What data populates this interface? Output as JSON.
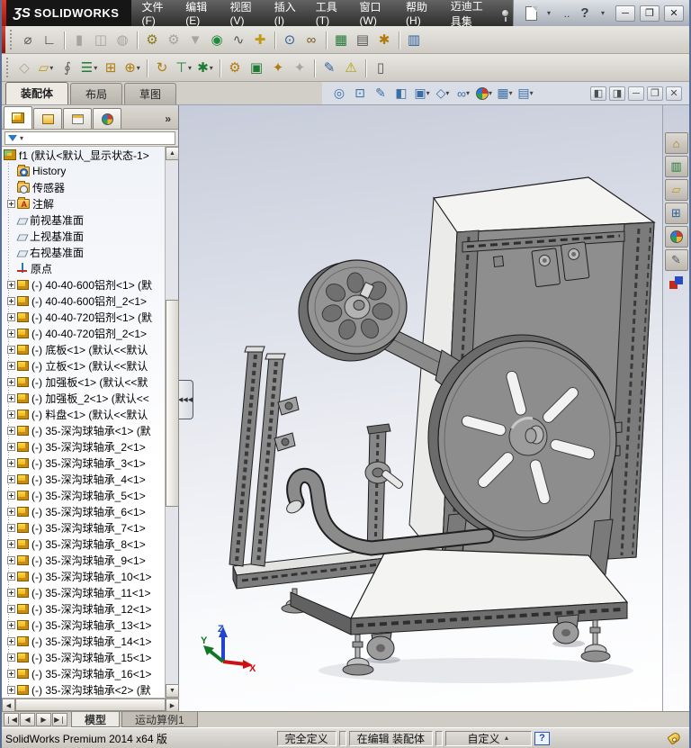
{
  "titlebar": {
    "logo_mark": "ƷS",
    "logo_text": "SOLIDWORKS",
    "menus": [
      {
        "name": "menu-file",
        "label": "文件(F)"
      },
      {
        "name": "menu-edit",
        "label": "编辑(E)"
      },
      {
        "name": "menu-view",
        "label": "视图(V)"
      },
      {
        "name": "menu-insert",
        "label": "插入(I)"
      },
      {
        "name": "menu-tools",
        "label": "工具(T)"
      },
      {
        "name": "menu-window",
        "label": "窗口(W)"
      },
      {
        "name": "menu-help",
        "label": "帮助(H)"
      },
      {
        "name": "menu-maidi-toolkit",
        "label": "迈迪工具集"
      }
    ],
    "quick_dots": "..",
    "help_glyph": "?",
    "min_glyph": "─",
    "restore_glyph": "❐",
    "close_glyph": "✕"
  },
  "toolbar1": [
    {
      "name": "screw-fastener-icon",
      "glyph": "⌀",
      "color": "#5a5a5a"
    },
    {
      "name": "corner-angle-icon",
      "glyph": "∟",
      "color": "#333333"
    },
    {
      "name": "publish-emodel-icon",
      "glyph": "▮",
      "color": "#888",
      "cls": "sep grayed"
    },
    {
      "name": "collaborate-icon",
      "glyph": "◫",
      "color": "#888",
      "cls": "grayed"
    },
    {
      "name": "web-globe-icon",
      "glyph": "◍",
      "color": "#888",
      "cls": "grayed"
    },
    {
      "name": "options-gear-icon",
      "glyph": "⚙",
      "color": "#8a7a1e",
      "cls": "sep"
    },
    {
      "name": "gear-disabled-icon",
      "glyph": "⚙",
      "color": "#888",
      "cls": "grayed"
    },
    {
      "name": "filter-funnel-icon",
      "glyph": "▼",
      "color": "#888",
      "cls": "grayed"
    },
    {
      "name": "location-pin-icon",
      "glyph": "◉",
      "color": "#1e8a3c"
    },
    {
      "name": "spring-icon",
      "glyph": "∿",
      "color": "#555555"
    },
    {
      "name": "move-cross-icon",
      "glyph": "✚",
      "color": "#c09a10"
    },
    {
      "name": "search-icon",
      "glyph": "⊙",
      "color": "#2b5fa0",
      "cls": "sep"
    },
    {
      "name": "binoculars-icon",
      "glyph": "∞",
      "color": "#7a5c20"
    },
    {
      "name": "excel-export-icon",
      "glyph": "▦",
      "color": "#1e7a34",
      "cls": "sep"
    },
    {
      "name": "print-icon",
      "glyph": "▤",
      "color": "#555555"
    },
    {
      "name": "new-doc-wizard-icon",
      "glyph": "✱",
      "color": "#b07c10"
    },
    {
      "name": "design-binder-icon",
      "glyph": "▥",
      "color": "#2b5fa0",
      "cls": "sep"
    }
  ],
  "toolbar2": [
    {
      "name": "insert-component-icon",
      "glyph": "◇",
      "color": "#888",
      "cls": "grayed"
    },
    {
      "name": "open-part-icon",
      "glyph": "▱",
      "color": "#c09a10",
      "caret": true
    },
    {
      "name": "mate-icon",
      "glyph": "∮",
      "color": "#606060"
    },
    {
      "name": "linear-pattern-icon",
      "glyph": "☰",
      "color": "#1e7a34",
      "caret": true
    },
    {
      "name": "smart-fasteners-icon",
      "glyph": "⊞",
      "color": "#b07c10"
    },
    {
      "name": "move-component-icon",
      "glyph": "⊕",
      "color": "#b07c10",
      "caret": true
    },
    {
      "name": "rotate-component-icon",
      "glyph": "↻",
      "color": "#b07c10",
      "cls": "sep"
    },
    {
      "name": "assembly-features-icon",
      "glyph": "⊤",
      "color": "#1e7a34",
      "caret": true
    },
    {
      "name": "reference-geometry-icon",
      "glyph": "✱",
      "color": "#1e7a34",
      "caret": true
    },
    {
      "name": "motion-study-icon",
      "glyph": "⚙",
      "color": "#b07c10",
      "cls": "sep"
    },
    {
      "name": "bom-shield-icon",
      "glyph": "▣",
      "color": "#1e7a34"
    },
    {
      "name": "exploded-view-icon",
      "glyph": "✦",
      "color": "#b07c10"
    },
    {
      "name": "explode-sketch-icon",
      "glyph": "✦",
      "color": "#888",
      "cls": "grayed"
    },
    {
      "name": "instant3d-icon",
      "glyph": "✎",
      "color": "#2b5fa0",
      "cls": "sep"
    },
    {
      "name": "interference-detection-icon",
      "glyph": "⚠",
      "color": "#b0a000"
    },
    {
      "name": "isolate-icon",
      "glyph": "▯",
      "color": "#555555",
      "cls": "sep"
    }
  ],
  "command_tabs": [
    {
      "name": "tab-assembly",
      "label": "装配体",
      "cls": "active"
    },
    {
      "name": "tab-layout",
      "label": "布局"
    },
    {
      "name": "tab-sketch",
      "label": "草图"
    }
  ],
  "headsup": [
    {
      "name": "zoom-fit-icon",
      "glyph": "◎"
    },
    {
      "name": "zoom-area-icon",
      "glyph": "⊡"
    },
    {
      "name": "magnified-selection-icon",
      "glyph": "✎"
    },
    {
      "name": "section-view-icon",
      "glyph": "◧"
    },
    {
      "name": "view-orientation-icon",
      "glyph": "▣",
      "caret": true
    },
    {
      "name": "display-style-icon",
      "glyph": "◇",
      "caret": true
    },
    {
      "name": "hide-show-items-icon",
      "glyph": "∞",
      "caret": true
    },
    {
      "name": "edit-appearance-icon",
      "glyph": "",
      "ball": true,
      "caret": true
    },
    {
      "name": "apply-scene-icon",
      "glyph": "▦",
      "caret": true
    },
    {
      "name": "view-settings-icon",
      "glyph": "▤",
      "caret": true
    }
  ],
  "doc_controls": [
    {
      "name": "tile-left-icon",
      "glyph": "◧"
    },
    {
      "name": "tile-right-icon",
      "glyph": "◨"
    },
    {
      "name": "minimize-doc-icon",
      "glyph": "─"
    },
    {
      "name": "restore-doc-icon",
      "glyph": "❐"
    },
    {
      "name": "close-doc-icon",
      "glyph": "✕"
    }
  ],
  "panel": {
    "chevron": "»",
    "tree_root": "f1  (默认<默认_显示状态-1>",
    "items": [
      {
        "name": "tree-history",
        "icon": "i-folder i-hist",
        "exp": "",
        "label": "History"
      },
      {
        "name": "tree-sensors",
        "icon": "i-folder i-sens",
        "exp": "",
        "label": "传感器"
      },
      {
        "name": "tree-annotations",
        "icon": "i-folder i-ann",
        "exp": "on",
        "label": "注解"
      },
      {
        "name": "tree-front-plane",
        "icon": "i-plane",
        "exp": "",
        "label": "前视基准面"
      },
      {
        "name": "tree-top-plane",
        "icon": "i-plane",
        "exp": "",
        "label": "上视基准面"
      },
      {
        "name": "tree-right-plane",
        "icon": "i-plane",
        "exp": "",
        "label": "右视基准面"
      },
      {
        "name": "tree-origin",
        "icon": "i-origin",
        "exp": "",
        "label": "原点"
      },
      {
        "name": "tree-component",
        "icon": "i-part",
        "exp": "on",
        "label": "(-) 40-40-600铝剂<1> (默"
      },
      {
        "name": "tree-component",
        "icon": "i-part",
        "exp": "on",
        "label": "(-) 40-40-600铝剂_2<1>"
      },
      {
        "name": "tree-component",
        "icon": "i-part",
        "exp": "on",
        "label": "(-) 40-40-720铝剂<1> (默"
      },
      {
        "name": "tree-component",
        "icon": "i-part",
        "exp": "on",
        "label": "(-) 40-40-720铝剂_2<1>"
      },
      {
        "name": "tree-component",
        "icon": "i-part",
        "exp": "on",
        "label": "(-) 底板<1> (默认<<默认"
      },
      {
        "name": "tree-component",
        "icon": "i-part",
        "exp": "on",
        "label": "(-) 立板<1> (默认<<默认"
      },
      {
        "name": "tree-component",
        "icon": "i-part",
        "exp": "on",
        "label": "(-) 加强板<1> (默认<<默"
      },
      {
        "name": "tree-component",
        "icon": "i-part",
        "exp": "on",
        "label": "(-) 加强板_2<1> (默认<<"
      },
      {
        "name": "tree-component",
        "icon": "i-part",
        "exp": "on",
        "label": "(-) 料盘<1> (默认<<默认"
      },
      {
        "name": "tree-component",
        "icon": "i-part",
        "exp": "on",
        "label": "(-) 35-深沟球轴承<1> (默"
      },
      {
        "name": "tree-component",
        "icon": "i-part",
        "exp": "on",
        "label": "(-) 35-深沟球轴承_2<1>"
      },
      {
        "name": "tree-component",
        "icon": "i-part",
        "exp": "on",
        "label": "(-) 35-深沟球轴承_3<1>"
      },
      {
        "name": "tree-component",
        "icon": "i-part",
        "exp": "on",
        "label": "(-) 35-深沟球轴承_4<1>"
      },
      {
        "name": "tree-component",
        "icon": "i-part",
        "exp": "on",
        "label": "(-) 35-深沟球轴承_5<1>"
      },
      {
        "name": "tree-component",
        "icon": "i-part",
        "exp": "on",
        "label": "(-) 35-深沟球轴承_6<1>"
      },
      {
        "name": "tree-component",
        "icon": "i-part",
        "exp": "on",
        "label": "(-) 35-深沟球轴承_7<1>"
      },
      {
        "name": "tree-component",
        "icon": "i-part",
        "exp": "on",
        "label": "(-) 35-深沟球轴承_8<1>"
      },
      {
        "name": "tree-component",
        "icon": "i-part",
        "exp": "on",
        "label": "(-) 35-深沟球轴承_9<1>"
      },
      {
        "name": "tree-component",
        "icon": "i-part",
        "exp": "on",
        "label": "(-) 35-深沟球轴承_10<1>"
      },
      {
        "name": "tree-component",
        "icon": "i-part",
        "exp": "on",
        "label": "(-) 35-深沟球轴承_11<1>"
      },
      {
        "name": "tree-component",
        "icon": "i-part",
        "exp": "on",
        "label": "(-) 35-深沟球轴承_12<1>"
      },
      {
        "name": "tree-component",
        "icon": "i-part",
        "exp": "on",
        "label": "(-) 35-深沟球轴承_13<1>"
      },
      {
        "name": "tree-component",
        "icon": "i-part",
        "exp": "on",
        "label": "(-) 35-深沟球轴承_14<1>"
      },
      {
        "name": "tree-component",
        "icon": "i-part",
        "exp": "on",
        "label": "(-) 35-深沟球轴承_15<1>"
      },
      {
        "name": "tree-component",
        "icon": "i-part",
        "exp": "on",
        "label": "(-) 35-深沟球轴承_16<1>"
      },
      {
        "name": "tree-component",
        "icon": "i-part",
        "exp": "on",
        "label": "(-) 35-深沟球轴承<2> (默"
      }
    ]
  },
  "taskpane": [
    {
      "name": "sw-resources-icon",
      "glyph": "⌂",
      "color": "#b07c10"
    },
    {
      "name": "design-library-icon",
      "glyph": "▥",
      "color": "#1e7a34"
    },
    {
      "name": "file-explorer-icon",
      "glyph": "▱",
      "color": "#c09a10"
    },
    {
      "name": "view-palette-icon",
      "glyph": "⊞",
      "color": "#2b5fa0"
    },
    {
      "name": "appearances-icon",
      "glyph": "",
      "ball": true
    },
    {
      "name": "custom-properties-icon",
      "glyph": "✎",
      "color": "#555555"
    }
  ],
  "canvas": {
    "triad": {
      "x": "X",
      "y": "Y",
      "z": "Z"
    }
  },
  "sheet_tabs": [
    {
      "name": "tab-model",
      "label": "模型",
      "cls": "active"
    },
    {
      "name": "tab-motion-study",
      "label": "运动算例1"
    }
  ],
  "statusbar": {
    "product": "SolidWorks Premium 2014 x64 版",
    "fully_defined": "完全定义",
    "editing": "在编辑 装配体",
    "custom": "自定义"
  }
}
